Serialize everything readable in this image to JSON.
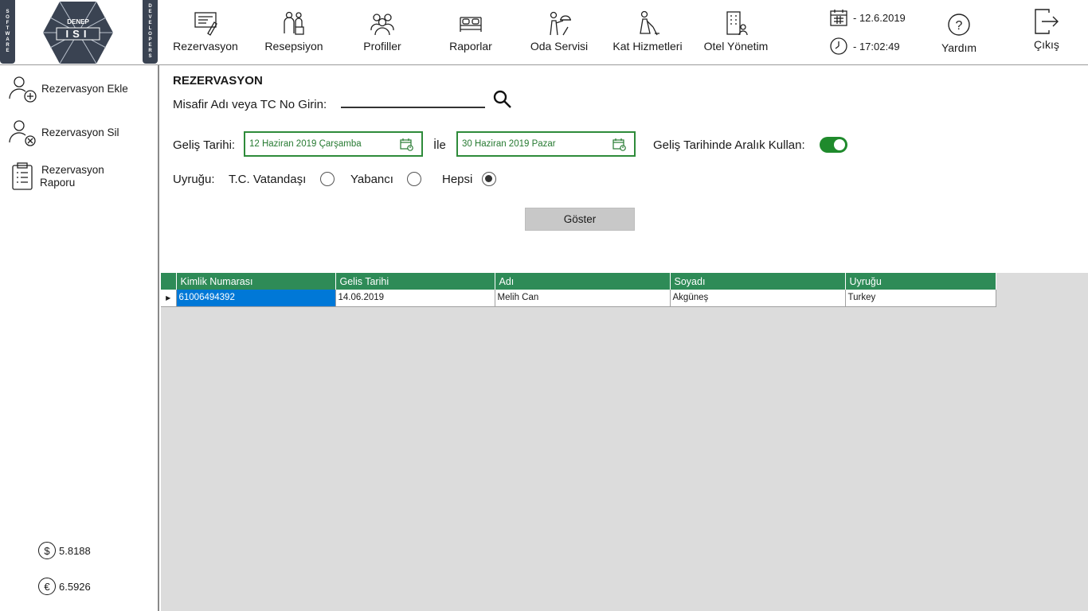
{
  "brand": {
    "left_strip": [
      "S",
      "O",
      "F",
      "T",
      "W",
      "A",
      "R",
      "E"
    ],
    "right_strip": [
      "D",
      "E",
      "V",
      "E",
      "L",
      "O",
      "P",
      "E",
      "R",
      "S"
    ],
    "logo_top": "DENEP",
    "logo_main": "ISI"
  },
  "nav": {
    "items": [
      {
        "label": "Rezervasyon",
        "icon": "reservation-icon"
      },
      {
        "label": "Resepsiyon",
        "icon": "reception-icon"
      },
      {
        "label": "Profiller",
        "icon": "profiles-icon"
      },
      {
        "label": "Raporlar",
        "icon": "bed-report-icon"
      },
      {
        "label": "Oda Servisi",
        "icon": "room-service-icon"
      },
      {
        "label": "Kat Hizmetleri",
        "icon": "housekeeping-icon"
      },
      {
        "label": "Otel Yönetim",
        "icon": "hotel-management-icon"
      }
    ],
    "date": "- 12.6.2019",
    "time": "- 17:02:49",
    "help_label": "Yardım",
    "exit_label": "Çıkış"
  },
  "sidebar": {
    "items": [
      {
        "label": "Rezervasyon Ekle",
        "icon": "user-add-icon"
      },
      {
        "label": "Rezervasyon Sil",
        "icon": "user-remove-icon"
      },
      {
        "label_line1": "Rezervasyon",
        "label_line2": "Raporu",
        "icon": "clipboard-icon"
      }
    ],
    "usd_symbol": "$",
    "usd_rate": "5.8188",
    "eur_symbol": "€",
    "eur_rate": "6.5926"
  },
  "form": {
    "title": "REZERVASYON",
    "search_label": "Misafir Adı veya TC No Girin:",
    "search_value": "",
    "arrival_label": "Geliş Tarihi:",
    "date_from": "12 Haziran 2019 Çarşamba",
    "between_label": "İle",
    "date_to": "30 Haziran 2019 Pazar",
    "range_toggle_label": "Geliş Tarihinde Aralık Kullan:",
    "range_toggle_on": true,
    "nationality_label": "Uyruğu:",
    "option_citizen": "T.C. Vatandaşı",
    "option_foreign": "Yabancı",
    "option_all": "Hepsi",
    "selected_option": "Hepsi",
    "show_button": "Göster"
  },
  "grid": {
    "columns": [
      "Kimlik Numarası",
      "Gelis Tarihi",
      "Adı",
      "Soyadı",
      "Uyruğu"
    ],
    "rows": [
      [
        "61006494392",
        "14.06.2019",
        "Melih Can",
        "Akgüneş",
        "Turkey"
      ]
    ]
  },
  "colors": {
    "accent_green": "#2e8b57",
    "date_border": "#2e8b3a",
    "toggle_on": "#1f8a2c",
    "selection_blue": "#0078d7",
    "strip_dark": "#3a4352"
  }
}
